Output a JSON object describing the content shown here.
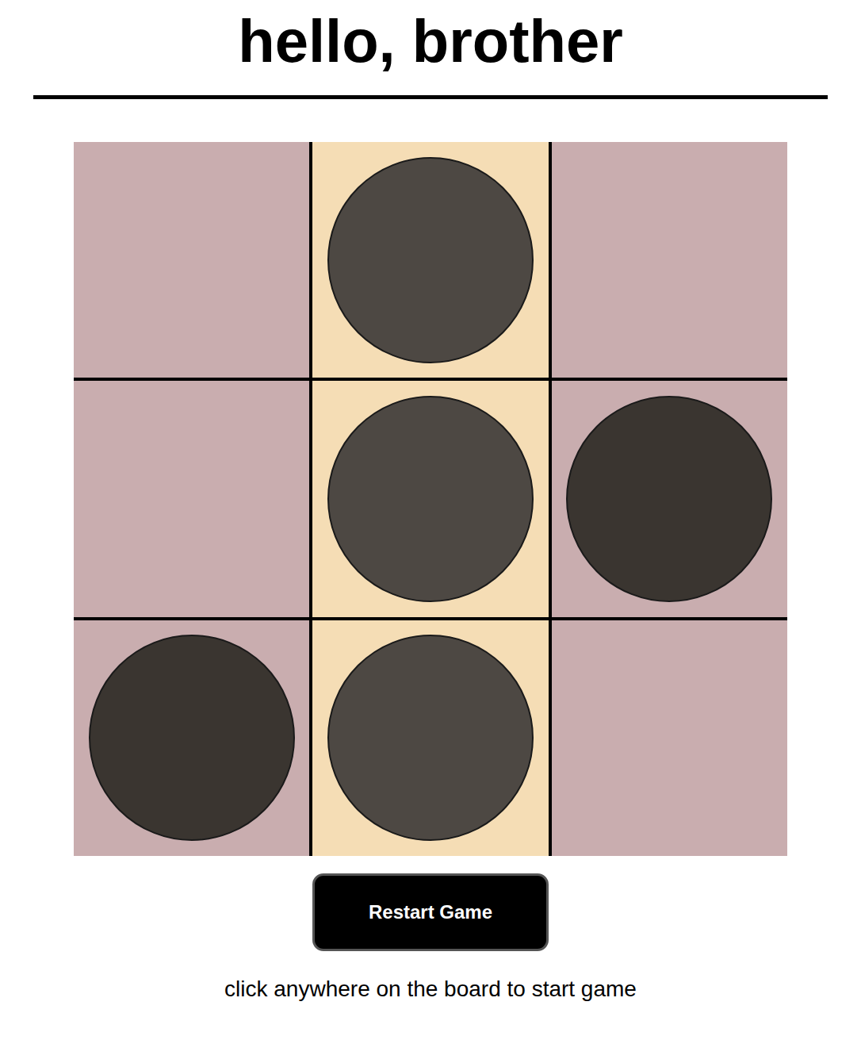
{
  "title": "hello, brother",
  "board": {
    "cells": [
      {
        "kind": "empty",
        "winning": false
      },
      {
        "kind": "damon",
        "winning": true
      },
      {
        "kind": "empty",
        "winning": false
      },
      {
        "kind": "empty",
        "winning": false
      },
      {
        "kind": "damon",
        "winning": true
      },
      {
        "kind": "stefan",
        "winning": false
      },
      {
        "kind": "stefan",
        "winning": false
      },
      {
        "kind": "damon",
        "winning": true
      },
      {
        "kind": "empty",
        "winning": false
      }
    ]
  },
  "restart_button": "Restart Game",
  "status": "click anywhere on the board to start game"
}
